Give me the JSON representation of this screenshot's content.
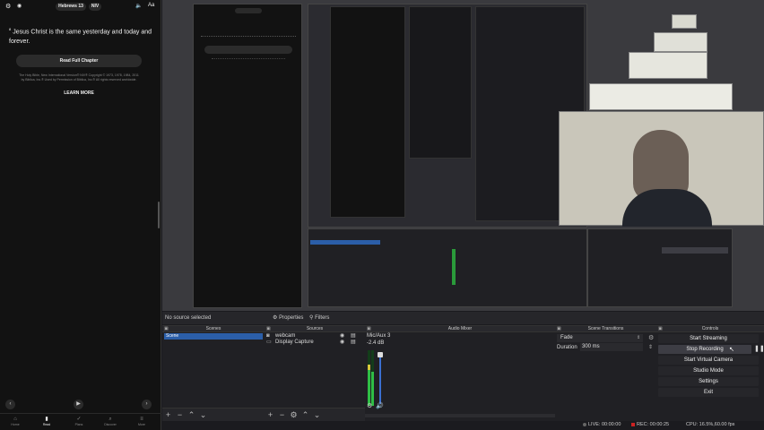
{
  "phone": {
    "book_pill": "Hebrews 13",
    "version_pill": "NIV",
    "aa": "Aa",
    "verse_num": "8",
    "verse_text": "Jesus Christ is the same yesterday and today and forever.",
    "read_full_chapter": "Read Full Chapter",
    "copyright": "The Holy Bible, New International Version® NIV® Copyright © 1973, 1978, 1984, 2011 by Biblica, Inc.® Used by Permission of Biblica, Inc.® All rights reserved worldwide.",
    "learn_more": "LEARN MORE",
    "bottom_nav": [
      {
        "label": "Home",
        "icon": "home-icon"
      },
      {
        "label": "Read",
        "icon": "book-icon"
      },
      {
        "label": "Plans",
        "icon": "check-icon"
      },
      {
        "label": "Discover",
        "icon": "search-icon"
      },
      {
        "label": "More",
        "icon": "menu-icon"
      }
    ]
  },
  "obs": {
    "no_source": "No source selected",
    "properties_tab": "Properties",
    "filters_tab": "Filters",
    "docks": {
      "scenes": "Scenes",
      "sources": "Sources",
      "mixer": "Audio Mixer",
      "transitions": "Scene Transitions",
      "controls": "Controls"
    },
    "scenes": [
      "Scene"
    ],
    "sources": [
      {
        "name": "webcam",
        "icon": "camera-icon"
      },
      {
        "name": "Display Capture",
        "icon": "monitor-icon"
      }
    ],
    "mixer": {
      "channel": "Mic/Aux 3",
      "db": "-2.4 dB"
    },
    "transitions": {
      "type": "Fade",
      "duration_label": "Duration",
      "duration_value": "300 ms"
    },
    "controls": [
      "Start Streaming",
      "Stop Recording",
      "Start Virtual Camera",
      "Studio Mode",
      "Settings",
      "Exit"
    ],
    "status": {
      "live": "LIVE: 00:00:00",
      "rec": "REC: 00:00:25",
      "cpu": "CPU: 16.5%,60.00 fps"
    }
  }
}
